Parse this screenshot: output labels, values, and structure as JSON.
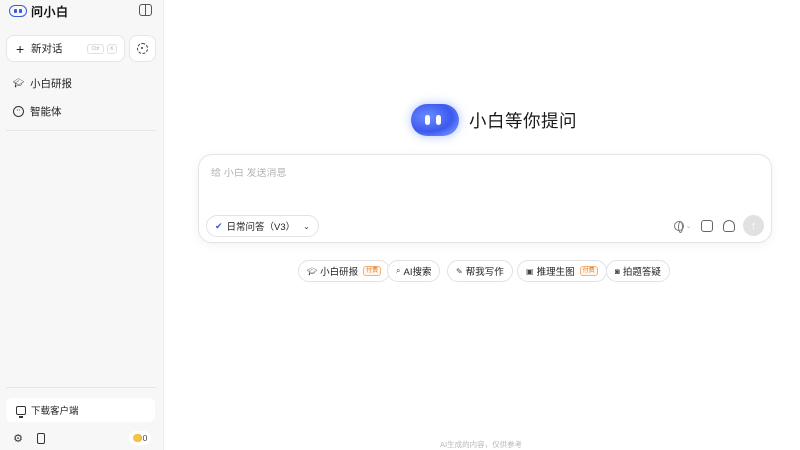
{
  "app": {
    "name": "问小白"
  },
  "sidebar": {
    "new_chat_label": "新对话",
    "shortcut_keys": [
      "Ctrl",
      "K"
    ],
    "nav_items": [
      {
        "label": "小白研报",
        "icon": "graduation-cap-icon"
      },
      {
        "label": "智能体",
        "icon": "agent-icon"
      }
    ],
    "download_label": "下载客户端",
    "coin_count": "0"
  },
  "main": {
    "hero_title": "小白等你提问",
    "input_placeholder": "给 小白 发送消息",
    "model_label": "日常问答（V3）",
    "chips": [
      {
        "label": "小白研报",
        "badge": "付费",
        "icon": "graduation-cap-icon"
      },
      {
        "label": "AI搜索",
        "badge": "",
        "icon": "search-icon"
      },
      {
        "label": "帮我写作",
        "badge": "",
        "icon": "pen-icon"
      },
      {
        "label": "推理生图",
        "badge": "付费",
        "icon": "image-icon"
      },
      {
        "label": "拍题答疑",
        "badge": "",
        "icon": "camera-icon"
      }
    ],
    "disclaimer": "AI生成的内容，仅供参考"
  },
  "colors": {
    "accent": "#3c59ef",
    "paid_badge": "#e07a1f",
    "sidebar_bg": "#f7f7f8"
  }
}
